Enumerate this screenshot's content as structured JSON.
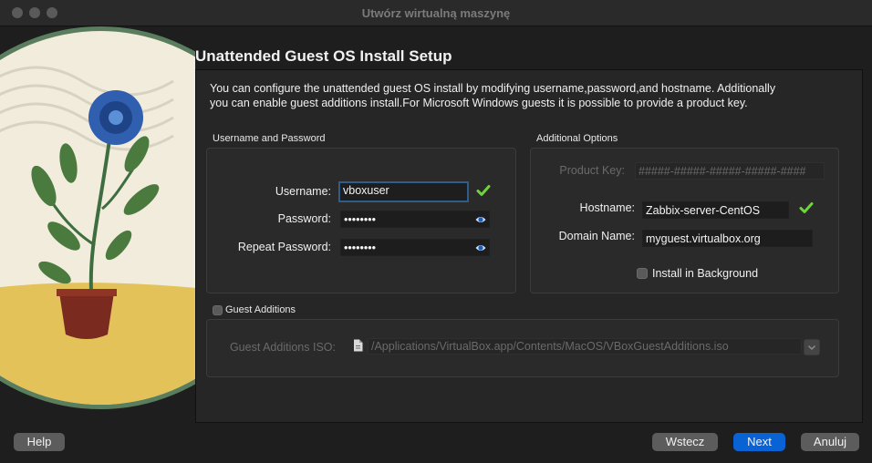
{
  "window": {
    "title": "Utwórz wirtualną maszynę"
  },
  "page": {
    "heading": "Unattended Guest OS Install Setup",
    "description": "You can configure the unattended guest OS install by modifying username,password,and hostname. Additionally you can enable guest additions install.For Microsoft Windows guests it is possible to provide a product key."
  },
  "credentials": {
    "section_label": "Username and Password",
    "username_label": "Username:",
    "username_value": "vboxuser",
    "password_label": "Password:",
    "password_value": "••••••••",
    "repeat_label": "Repeat Password:",
    "repeat_value": "••••••••"
  },
  "additional": {
    "section_label": "Additional Options",
    "product_key_label": "Product Key:",
    "product_key_value": "#####-#####-#####-#####-####",
    "hostname_label": "Hostname:",
    "hostname_value": "Zabbix-server-CentOS",
    "domain_label": "Domain Name:",
    "domain_value": "myguest.virtualbox.org",
    "install_bg_label": "Install in Background"
  },
  "guest_additions": {
    "checkbox_label": "Guest Additions",
    "iso_label": "Guest Additions ISO:",
    "iso_value": "/Applications/VirtualBox.app/Contents/MacOS/VBoxGuestAdditions.iso"
  },
  "buttons": {
    "help": "Help",
    "back": "Wstecz",
    "next": "Next",
    "cancel": "Anuluj"
  },
  "colors": {
    "accent": "#0a63d4",
    "valid": "#6fd33a",
    "focus": "#2f5d8a"
  }
}
